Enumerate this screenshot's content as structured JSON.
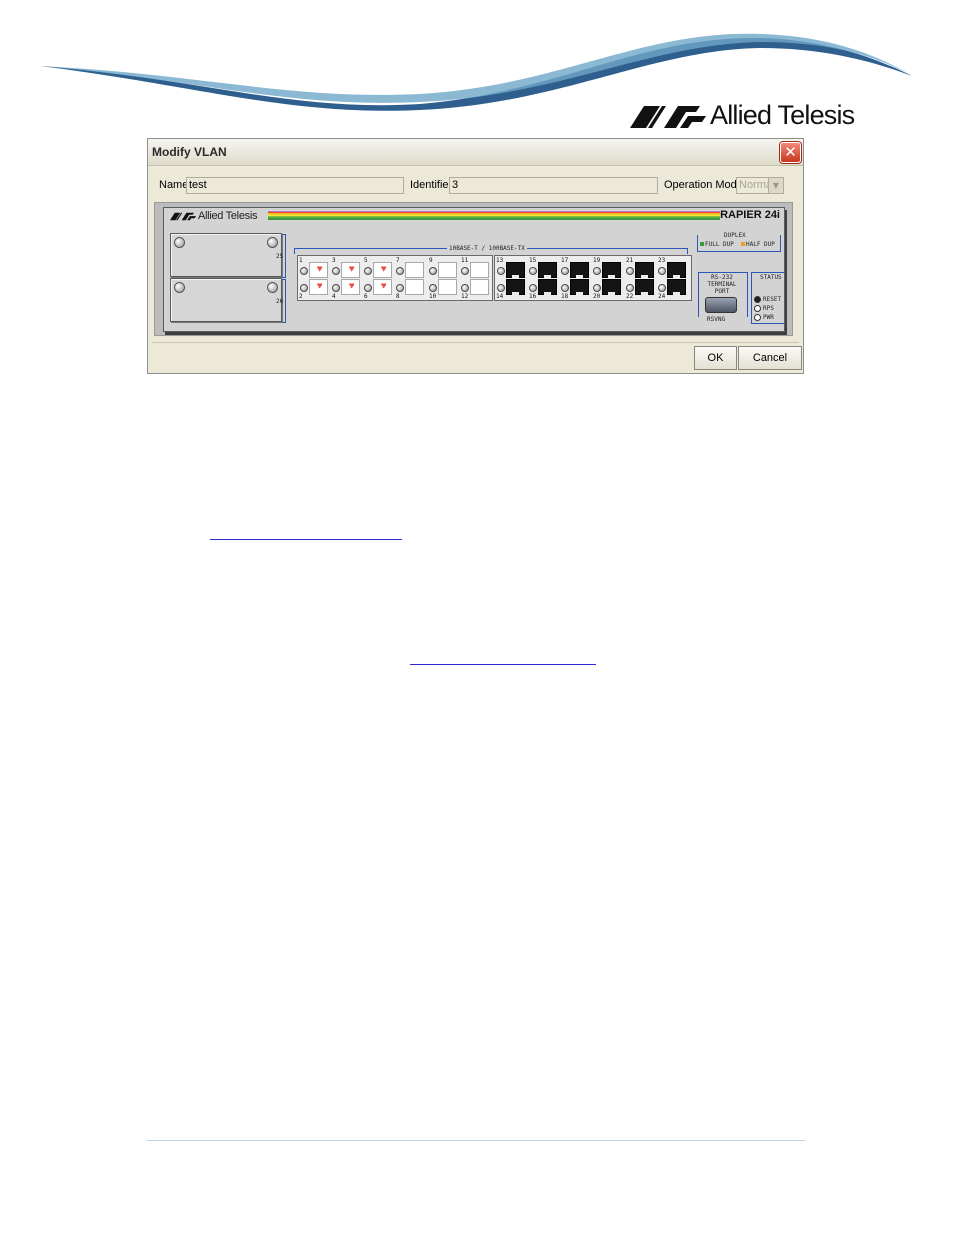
{
  "brand": {
    "company": "Allied Telesis"
  },
  "dialog": {
    "title": "Modify VLAN",
    "close_symbol": "✕",
    "fields": {
      "name_label": "Name",
      "name_value": "test",
      "identifier_label": "Identifier",
      "identifier_value": "3",
      "operation_mode_label": "Operation Mode",
      "operation_mode_value": "Normal"
    },
    "switch": {
      "brand": "Allied Telesis",
      "model": "RAPIER 24i",
      "module_ports": [
        "25",
        "26"
      ],
      "port_type_label": "10BASE-T / 100BASE-TX",
      "ports_top": [
        "1",
        "3",
        "5",
        "7",
        "9",
        "11",
        "13",
        "15",
        "17",
        "19",
        "21",
        "23"
      ],
      "ports_bottom": [
        "2",
        "4",
        "6",
        "8",
        "10",
        "12",
        "14",
        "16",
        "18",
        "20",
        "22",
        "24"
      ],
      "duplex_label": "DUPLEX",
      "full_dup_label": "FULL DUP",
      "half_dup_label": "HALF DUP",
      "terminal_port_label": "RS-232 TERMINAL PORT",
      "console_label": "RSVNG",
      "status_label": "STATUS",
      "status_items": [
        "RESET",
        "RPS",
        "PWR"
      ],
      "colors": {
        "full_dup_led": "#3c9a3c",
        "half_dup_led": "#f0a020",
        "bracket": "#2e55b8"
      }
    },
    "buttons": {
      "ok": "OK",
      "cancel": "Cancel"
    }
  },
  "icons": [
    "close-icon",
    "allied-telesis-logo-icon",
    "screw-icon",
    "port-icon",
    "cable-icon",
    "led-icon",
    "db9-connector-icon",
    "radio-icon",
    "dropdown-arrow-icon"
  ]
}
